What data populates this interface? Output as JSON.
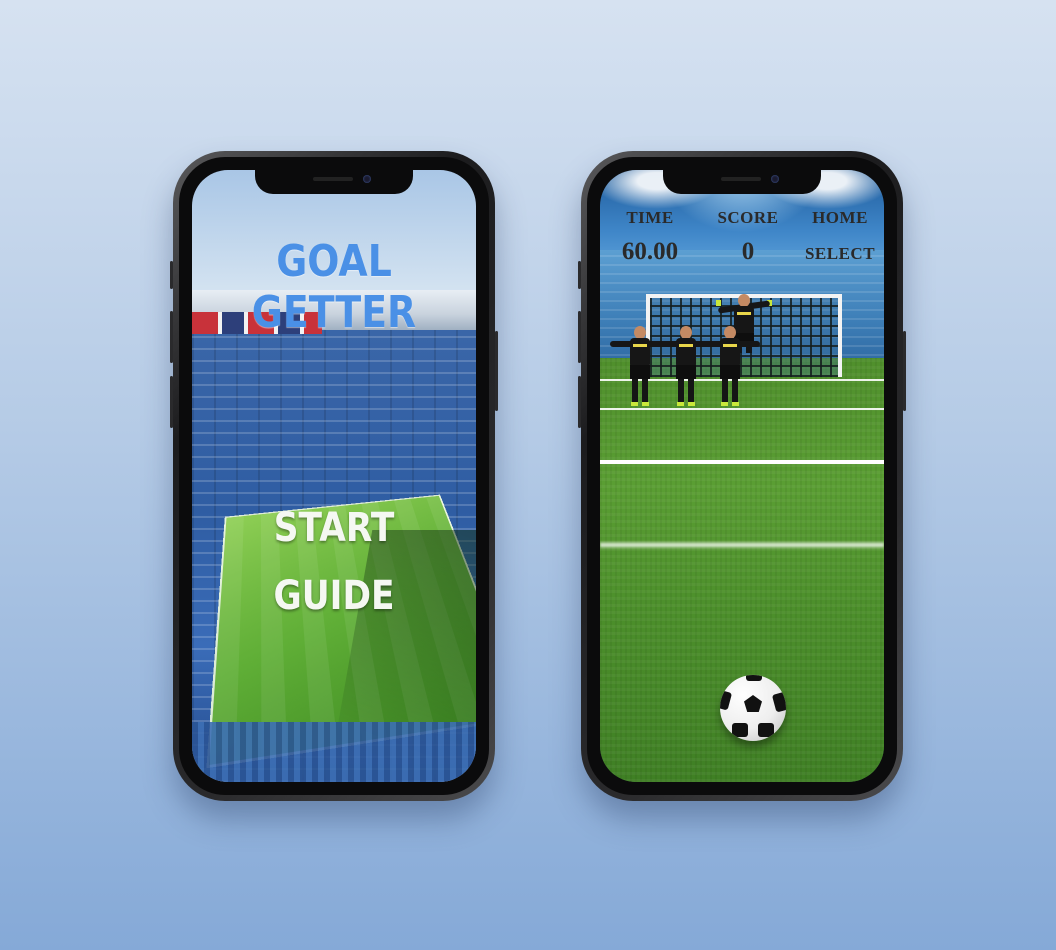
{
  "background": {
    "top_color": "#d6e2f1",
    "bottom_color": "#85a9d7"
  },
  "menu_screen": {
    "title": "GOAL GETTER",
    "title_color": "#4a90e6",
    "buttons": {
      "start": "START",
      "guide": "GUIDE"
    },
    "button_color": "#f5f8f2"
  },
  "game_screen": {
    "hud": {
      "time_label": "TIME",
      "time_value": "60.00",
      "score_label": "SCORE",
      "score_value": "0",
      "home_label": "HOME",
      "select_label": "SELECT"
    },
    "wall_player_count": 3,
    "icons": [
      "goal-icon",
      "goalkeeper-icon",
      "defender-icon",
      "soccer-ball-icon"
    ]
  }
}
